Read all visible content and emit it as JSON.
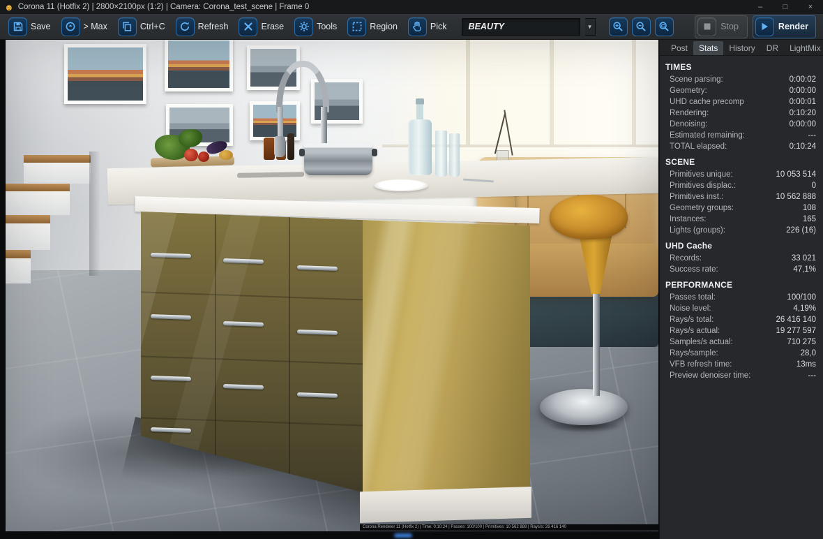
{
  "window": {
    "title": "Corona 11 (Hotfix 2) | 2800×2100px (1:2) | Camera: Corona_test_scene | Frame 0",
    "controls": {
      "minimize": "–",
      "maximize": "□",
      "close": "×"
    }
  },
  "colors": {
    "accent_blue": "#5fb0f4",
    "panel_bg": "#26282b",
    "island_gold": "#b89f55"
  },
  "toolbar": {
    "buttons": [
      {
        "name": "save",
        "label": "Save",
        "icon": "save-icon"
      },
      {
        "name": "max",
        "label": "> Max",
        "icon": "send-to-max-icon"
      },
      {
        "name": "copy",
        "label": "Ctrl+C",
        "icon": "copy-icon"
      },
      {
        "name": "refresh",
        "label": "Refresh",
        "icon": "refresh-icon"
      },
      {
        "name": "erase",
        "label": "Erase",
        "icon": "erase-icon"
      },
      {
        "name": "tools",
        "label": "Tools",
        "icon": "tools-icon"
      },
      {
        "name": "region",
        "label": "Region",
        "icon": "region-icon"
      },
      {
        "name": "pick",
        "label": "Pick",
        "icon": "pick-icon"
      }
    ],
    "channel": {
      "value": "BEAUTY"
    },
    "zoom": [
      {
        "name": "zoom-in",
        "icon": "zoom-in-icon"
      },
      {
        "name": "zoom-out",
        "icon": "zoom-out-icon"
      },
      {
        "name": "zoom-reset",
        "icon": "zoom-reset-icon"
      }
    ],
    "stop_label": "Stop",
    "render_label": "Render"
  },
  "panel": {
    "tabs": [
      {
        "label": "Post"
      },
      {
        "label": "Stats",
        "active": true
      },
      {
        "label": "History"
      },
      {
        "label": "DR"
      },
      {
        "label": "LightMix"
      }
    ],
    "sections": [
      {
        "title": "TIMES",
        "rows": [
          [
            "Scene parsing:",
            "0:00:02"
          ],
          [
            "Geometry:",
            "0:00:00"
          ],
          [
            "UHD cache precomp",
            "0:00:01"
          ],
          [
            "Rendering:",
            "0:10:20"
          ],
          [
            "Denoising:",
            "0:00:00"
          ],
          [
            "Estimated remaining:",
            "---"
          ],
          [
            "TOTAL elapsed:",
            "0:10:24"
          ]
        ]
      },
      {
        "title": "SCENE",
        "rows": [
          [
            "Primitives unique:",
            "10 053 514"
          ],
          [
            "Primitives displac.:",
            "0"
          ],
          [
            "Primitives inst.:",
            "10 562 888"
          ],
          [
            "Geometry groups:",
            "108"
          ],
          [
            "Instances:",
            "165"
          ],
          [
            "Lights (groups):",
            "226 (16)"
          ]
        ]
      },
      {
        "title": "UHD Cache",
        "rows": [
          [
            "Records:",
            "33 021"
          ],
          [
            "Success rate:",
            "47,1%"
          ]
        ]
      },
      {
        "title": "PERFORMANCE",
        "rows": [
          [
            "Passes total:",
            "100/100"
          ],
          [
            "Noise level:",
            "4,19%"
          ],
          [
            "Rays/s total:",
            "26 416 140"
          ],
          [
            "Rays/s actual:",
            "19 277 597"
          ],
          [
            "Samples/s actual:",
            "710 275"
          ],
          [
            "Rays/sample:",
            "28,0"
          ],
          [
            "VFB refresh time:",
            "13ms"
          ],
          [
            "Preview denoiser time:",
            "---"
          ]
        ]
      }
    ]
  },
  "render_stamp": "Corona Renderer 11 (Hotfix 2) | Time: 0:10:24 | Passes: 100/100 | Primitives: 10 562 888 | Rays/s: 26 416 140"
}
